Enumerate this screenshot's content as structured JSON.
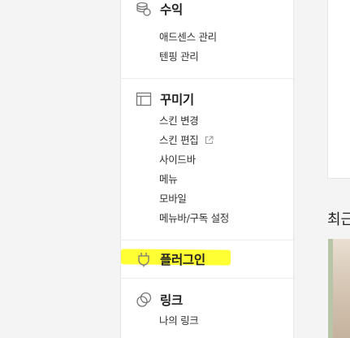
{
  "sidebar": {
    "revenue": {
      "icon": "coins-icon",
      "title": "수익",
      "items": [
        "애드센스 관리",
        "텐핑 관리"
      ]
    },
    "customize": {
      "icon": "layout-icon",
      "title": "꾸미기",
      "items": [
        "스킨 변경",
        "스킨 편집",
        "사이드바",
        "메뉴",
        "모바일",
        "메뉴바/구독 설정"
      ],
      "external_icon": "external-link-icon"
    },
    "plugin": {
      "icon": "plug-icon",
      "title": "플러그인",
      "highlight_color": "#ffff33"
    },
    "link": {
      "icon": "link-rings-icon",
      "title": "링크",
      "items": [
        "나의 링크"
      ]
    }
  },
  "right_panel": {
    "heading": "최근"
  }
}
